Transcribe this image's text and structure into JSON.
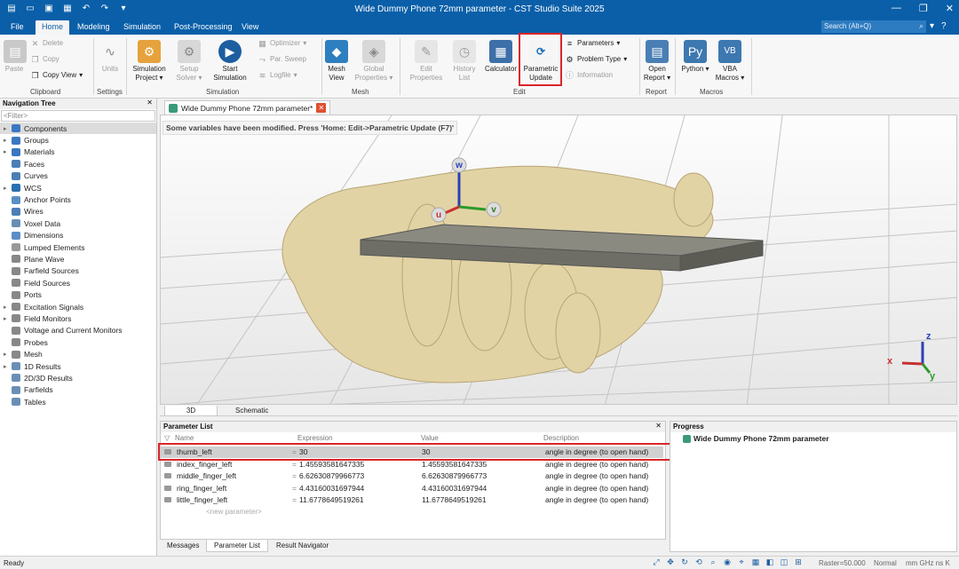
{
  "window": {
    "title": "Wide Dummy Phone 72mm parameter - CST Studio Suite 2025",
    "quick_access": [
      "new-icon",
      "open-icon",
      "save-icon",
      "save-all-icon",
      "undo-icon",
      "redo-icon",
      "dropdown-icon"
    ]
  },
  "menu": {
    "items": [
      "File",
      "Home",
      "Modeling",
      "Simulation",
      "Post-Processing",
      "View"
    ],
    "active": "Home",
    "search_placeholder": "Search (Alt+Q)"
  },
  "ribbon": {
    "clipboard": {
      "paste": "Paste",
      "delete": "Delete",
      "copy": "Copy",
      "copy_view": "Copy View",
      "group": "Clipboard"
    },
    "settings": {
      "units": "Units",
      "group": "Settings"
    },
    "simulation": {
      "project": "Simulation Project",
      "setup": "Setup Solver",
      "start": "Start Simulation",
      "optimizer": "Optimizer",
      "par_sweep": "Par. Sweep",
      "logfile": "Logfile",
      "group": "Simulation"
    },
    "mesh": {
      "mesh_view": "Mesh View",
      "global_props": "Global Properties",
      "group": "Mesh"
    },
    "edit": {
      "edit_props": "Edit Properties",
      "history": "History List",
      "calculator": "Calculator",
      "param_update": "Parametric Update",
      "parameters": "Parameters",
      "problem_type": "Problem Type",
      "information": "Information",
      "group": "Edit"
    },
    "report": {
      "open_report": "Open Report",
      "group": "Report"
    },
    "macros": {
      "python": "Python",
      "vba": "VBA Macros",
      "group": "Macros"
    }
  },
  "nav_tree": {
    "title": "Navigation Tree",
    "filter_placeholder": "<Filter>",
    "items": [
      {
        "label": "Components",
        "expand": true,
        "selected": true
      },
      {
        "label": "Groups",
        "expand": true
      },
      {
        "label": "Materials",
        "expand": true
      },
      {
        "label": "Faces",
        "expand": false
      },
      {
        "label": "Curves",
        "expand": false
      },
      {
        "label": "WCS",
        "expand": true
      },
      {
        "label": "Anchor Points",
        "expand": false
      },
      {
        "label": "Wires",
        "expand": false
      },
      {
        "label": "Voxel Data",
        "expand": false
      },
      {
        "label": "Dimensions",
        "expand": false
      },
      {
        "label": "Lumped Elements",
        "expand": false
      },
      {
        "label": "Plane Wave",
        "expand": false
      },
      {
        "label": "Farfield Sources",
        "expand": false
      },
      {
        "label": "Field Sources",
        "expand": false
      },
      {
        "label": "Ports",
        "expand": false
      },
      {
        "label": "Excitation Signals",
        "expand": true
      },
      {
        "label": "Field Monitors",
        "expand": true
      },
      {
        "label": "Voltage and Current Monitors",
        "expand": false
      },
      {
        "label": "Probes",
        "expand": false
      },
      {
        "label": "Mesh",
        "expand": true
      },
      {
        "label": "1D Results",
        "expand": true
      },
      {
        "label": "2D/3D Results",
        "expand": false
      },
      {
        "label": "Farfields",
        "expand": false
      },
      {
        "label": "Tables",
        "expand": false
      }
    ]
  },
  "document_tab": {
    "label": "Wide Dummy Phone 72mm parameter*"
  },
  "viewport": {
    "message": "Some variables have been modified. Press 'Home: Edit->Parametric Update (F7)'",
    "wcs_axes": [
      "u",
      "v",
      "w"
    ],
    "global_axes": [
      "x",
      "y",
      "z"
    ]
  },
  "view_tabs": [
    "3D",
    "Schematic"
  ],
  "parameter_list": {
    "title": "Parameter List",
    "columns": [
      "Name",
      "Expression",
      "Value",
      "Description"
    ],
    "rows": [
      {
        "name": "thumb_left",
        "expression": "30",
        "value": "30",
        "description": "angle in degree (to open hand)",
        "selected": true
      },
      {
        "name": "index_finger_left",
        "expression": "1.45593581647335",
        "value": "1.45593581647335",
        "description": "angle in degree (to open hand)"
      },
      {
        "name": "middle_finger_left",
        "expression": "6.62630879966773",
        "value": "6.62630879966773",
        "description": "angle in degree (to open hand)"
      },
      {
        "name": "ring_finger_left",
        "expression": "4.43160031697944",
        "value": "4.43160031697944",
        "description": "angle in degree (to open hand)"
      },
      {
        "name": "little_finger_left",
        "expression": "11.6778649519261",
        "value": "11.6778649519261",
        "description": "angle in degree (to open hand)"
      }
    ],
    "new_parameter": "<new parameter>"
  },
  "bottom_tabs": [
    "Messages",
    "Parameter List",
    "Result Navigator"
  ],
  "progress": {
    "title": "Progress",
    "item": "Wide Dummy Phone 72mm parameter"
  },
  "status": {
    "ready": "Ready",
    "raster": "Raster=50.000",
    "mode": "Normal",
    "units": "mm  GHz  ns  K"
  },
  "colors": {
    "brand": "#0a5fa8",
    "highlight": "#d9262b",
    "hand": "#e2d3a5",
    "phone": "#8a8a80"
  }
}
